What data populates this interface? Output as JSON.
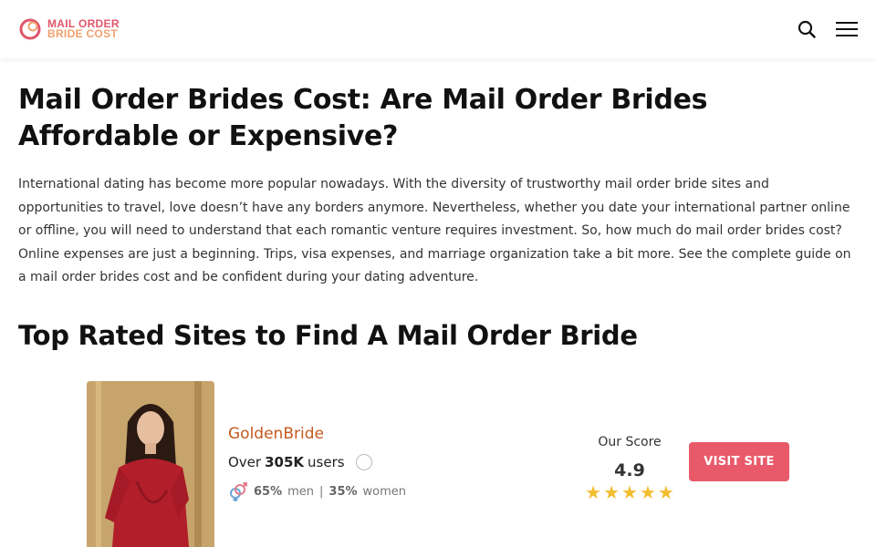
{
  "header": {
    "logo": {
      "line1": "MAIL ORDER",
      "line2": "BRIDE COST"
    },
    "search_icon": "search-icon",
    "menu_icon": "hamburger-menu-icon"
  },
  "article": {
    "title": "Mail Order Brides Cost: Are Mail Order Brides Affordable or Expensive?",
    "intro": "International dating has become more popular nowadays. With the diversity of trustworthy mail order bride sites and opportunities to travel, love doesn’t have any borders anymore. Nevertheless, whether you date your international partner online or offline, you will need to understand that each romantic venture requires investment. So, how much do mail order brides cost? Online expenses are just a beginning. Trips, visa expenses, and marriage organization take a bit more. See the complete guide on a mail order brides cost and be confident during your dating adventure.",
    "section_heading": "Top Rated Sites to Find A Mail Order Bride"
  },
  "site_card": {
    "name": "GoldenBride",
    "users_prefix": "Over",
    "users_count": "305K",
    "users_suffix": "users",
    "men_percent": "65%",
    "men_label": "men",
    "separator": "|",
    "women_percent": "35%",
    "women_label": "women",
    "score_label": "Our Score",
    "score_value": "4.9",
    "stars": 5,
    "visit_label": "VISIT SITE"
  },
  "colors": {
    "accent": "#e85a6a",
    "site_name": "#c65a1e",
    "star": "#f3bd2f"
  }
}
